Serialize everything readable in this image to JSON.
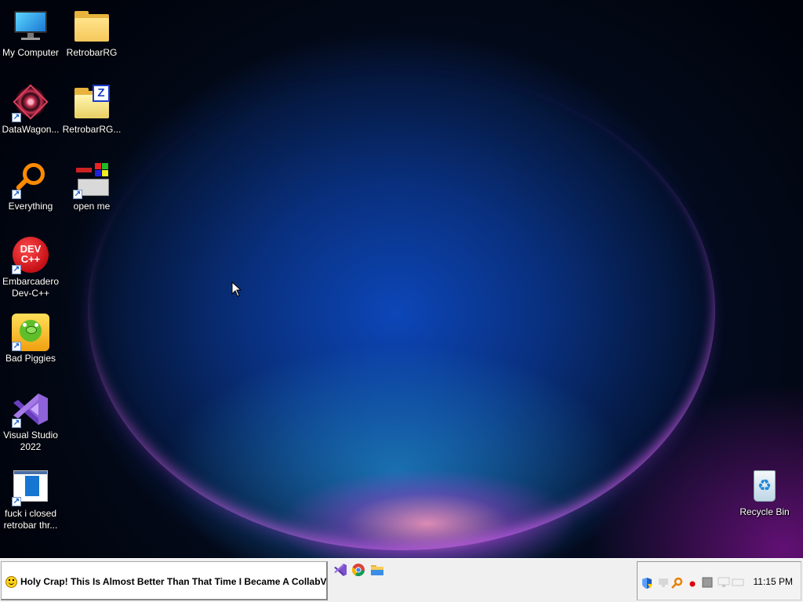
{
  "desktop": {
    "icons": [
      {
        "label": "My Computer",
        "icon": "computer-icon"
      },
      {
        "label": "RetrobarRG",
        "icon": "folder-icon"
      },
      {
        "label": "DataWagon...",
        "icon": "datawagon-icon"
      },
      {
        "label": "RetrobarRG...",
        "icon": "zip-folder-icon"
      },
      {
        "label": "Everything",
        "icon": "everything-search-icon"
      },
      {
        "label": "open me",
        "icon": "open-me-icon"
      },
      {
        "label": "Embarcadero Dev-C++",
        "icon": "devcpp-icon",
        "badge": "DEV C++"
      },
      {
        "label": "Bad Piggies",
        "icon": "bad-piggies-icon"
      },
      {
        "label": "Visual Studio 2022",
        "icon": "visual-studio-icon"
      },
      {
        "label": "fuck i closed retrobar thr...",
        "icon": "text-document-icon"
      },
      {
        "label": "Recycle Bin",
        "icon": "recycle-bin-icon"
      }
    ]
  },
  "taskbar": {
    "start_label": "Holy Crap! This Is Almost Better Than That Time I Became A CollabVM!",
    "quick_launch": [
      "visual-studio-icon",
      "chrome-icon",
      "file-explorer-icon"
    ],
    "tray_icons": [
      "security-shield-icon",
      "network-icon",
      "everything-search-icon",
      "recording-dot-icon",
      "generic-app-icon",
      "monitor-icon",
      "keyboard-icon"
    ],
    "clock": "11:15 PM"
  },
  "colors": {
    "taskbar": "#f0f0f0",
    "accent_blue": "#0c46b8"
  }
}
